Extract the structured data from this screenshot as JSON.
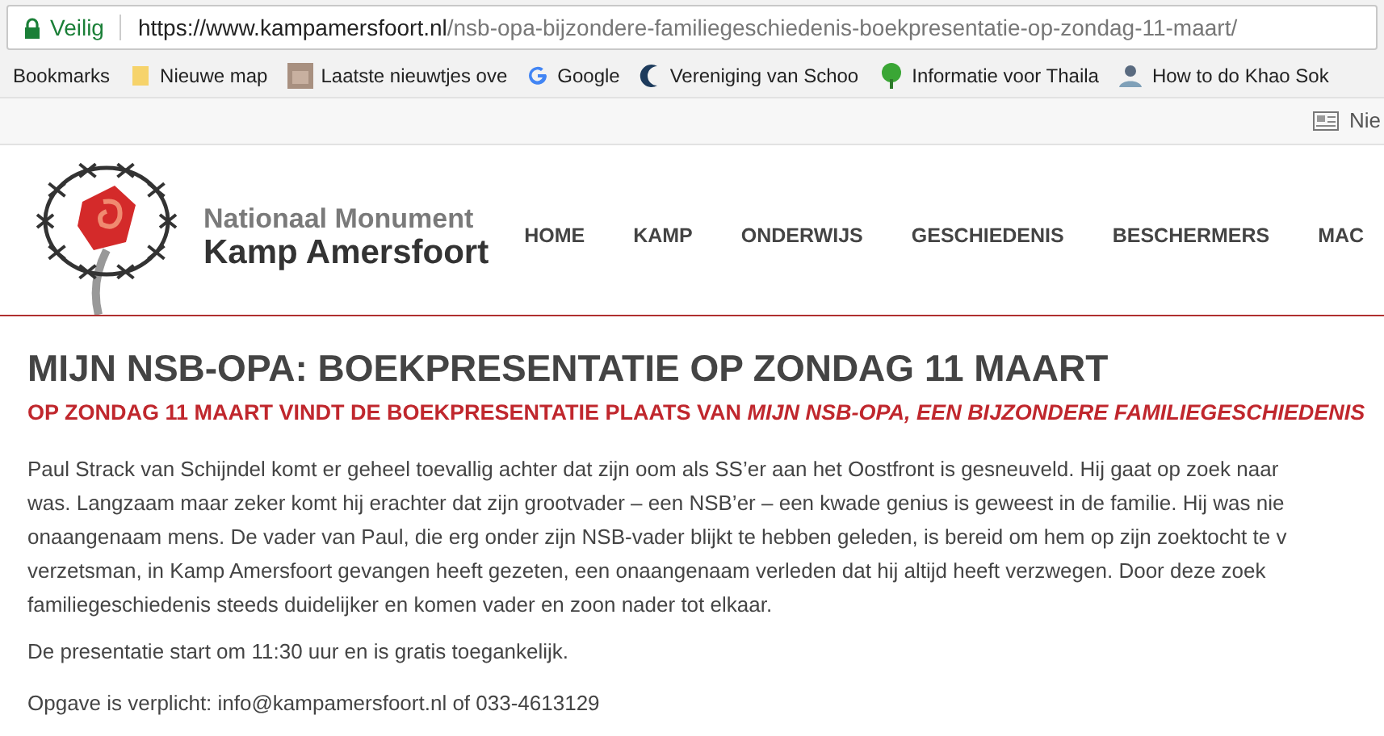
{
  "browser": {
    "security_label": "Veilig",
    "url_host": "https://www.kampamersfoort.nl",
    "url_path": "/nsb-opa-bijzondere-familiegeschiedenis-boekpresentatie-op-zondag-11-maart/"
  },
  "bookmarks": [
    {
      "label": "Bookmarks",
      "kind": "plain"
    },
    {
      "label": "Nieuwe map",
      "kind": "folder"
    },
    {
      "label": "Laatste nieuwtjes ove",
      "kind": "photo"
    },
    {
      "label": "Google",
      "kind": "google"
    },
    {
      "label": "Vereniging van Schoo",
      "kind": "crescent"
    },
    {
      "label": "Informatie voor Thaila",
      "kind": "tree"
    },
    {
      "label": "How to do Khao Sok",
      "kind": "person"
    }
  ],
  "toolbar": {
    "reader_label": "Nie"
  },
  "site": {
    "logo_line_1": "Nationaal Monument",
    "logo_line_2": "Kamp Amersfoort",
    "nav": [
      "HOME",
      "KAMP",
      "ONDERWIJS",
      "GESCHIEDENIS",
      "BESCHERMERS",
      "MAC"
    ]
  },
  "article": {
    "title": "MIJN NSB-OPA: BOEKPRESENTATIE OP ZONDAG 11 MAART",
    "subtitle": "OP ZONDAG 11 MAART VINDT DE BOEKPRESENTATIE PLAATS VAN *MIJN NSB-OPA, EEN BIJZONDERE FAMILIEGESCHIEDENIS*",
    "paragraph_lines": [
      "Paul Strack van Schijndel komt er geheel toevallig achter dat zijn oom als SS’er aan het Oostfront is gesneuveld. Hij gaat op zoek naar",
      "was. Langzaam maar zeker komt hij erachter dat zijn grootvader – een NSB’er – een kwade genius is geweest in de familie. Hij was nie",
      "onaangenaam mens. De vader van Paul, die erg onder zijn NSB-vader blijkt te hebben geleden, is bereid om hem op zijn zoektocht te v",
      "verzetsman, in Kamp Amersfoort gevangen heeft gezeten, een onaangenaam verleden dat hij altijd heeft verzwegen. Door deze zoek",
      "familiegeschiedenis steeds duidelijker en komen vader en zoon nader tot elkaar."
    ],
    "time_note": "De presentatie start om 11:30 uur en is gratis toegankelijk.",
    "signup_note": "Opgave is verplicht: info@kampamersfoort.nl of 033-4613129"
  }
}
